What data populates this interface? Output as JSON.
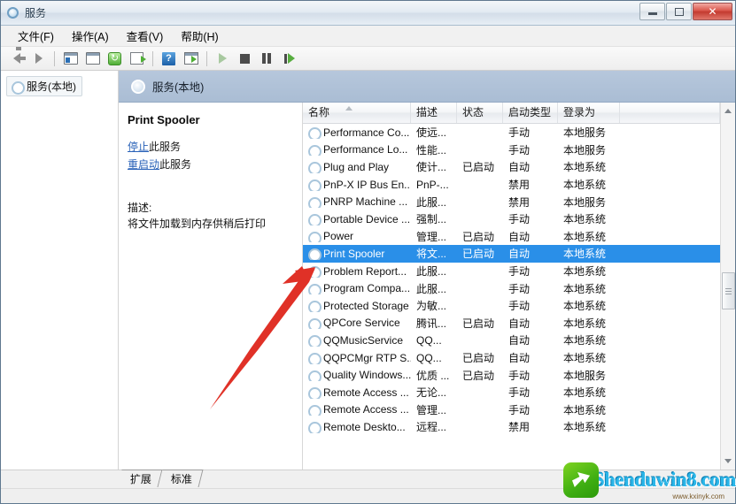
{
  "window": {
    "title": "服务",
    "title_icon": "services-gear-icon",
    "buttons": {
      "minimize": "minimize-icon",
      "maximize": "maximize-icon",
      "close": "✕"
    }
  },
  "menu": {
    "items": [
      {
        "label": "文件(F)",
        "name": "menu-file"
      },
      {
        "label": "操作(A)",
        "name": "menu-action"
      },
      {
        "label": "查看(V)",
        "name": "menu-view"
      },
      {
        "label": "帮助(H)",
        "name": "menu-help"
      }
    ]
  },
  "toolbar": {
    "items": [
      {
        "name": "back-icon"
      },
      {
        "name": "forward-icon"
      },
      {
        "name": "show-hide-tree-icon"
      },
      {
        "name": "properties-icon"
      },
      {
        "name": "refresh-icon"
      },
      {
        "name": "export-list-icon"
      },
      {
        "name": "help-icon"
      },
      {
        "name": "show-action-pane-icon"
      },
      {
        "name": "start-service-icon"
      },
      {
        "name": "stop-service-icon"
      },
      {
        "name": "pause-service-icon"
      },
      {
        "name": "restart-service-icon"
      }
    ]
  },
  "sidebar": {
    "items": [
      {
        "label": "服务(本地)",
        "name": "tree-item-services-local"
      }
    ]
  },
  "pane_header": {
    "title": "服务(本地)"
  },
  "detail": {
    "service_name": "Print Spooler",
    "stop_link": "停止",
    "stop_suffix": "此服务",
    "restart_link": "重启动",
    "restart_suffix": "此服务",
    "description_label": "描述:",
    "description_text": "将文件加载到内存供稍后打印"
  },
  "table": {
    "columns": [
      {
        "label": "名称",
        "name": "col-name"
      },
      {
        "label": "描述",
        "name": "col-description"
      },
      {
        "label": "状态",
        "name": "col-status"
      },
      {
        "label": "启动类型",
        "name": "col-startup-type"
      },
      {
        "label": "登录为",
        "name": "col-log-on-as"
      }
    ],
    "sort": "ascending",
    "rows": [
      {
        "name": "Performance Co...",
        "desc": "使远...",
        "status": "",
        "startup": "手动",
        "logon": "本地服务",
        "selected": false
      },
      {
        "name": "Performance Lo...",
        "desc": "性能...",
        "status": "",
        "startup": "手动",
        "logon": "本地服务",
        "selected": false
      },
      {
        "name": "Plug and Play",
        "desc": "使计...",
        "status": "已启动",
        "startup": "自动",
        "logon": "本地系统",
        "selected": false
      },
      {
        "name": "PnP-X IP Bus En...",
        "desc": "PnP-...",
        "status": "",
        "startup": "禁用",
        "logon": "本地系统",
        "selected": false
      },
      {
        "name": "PNRP Machine ...",
        "desc": "此服...",
        "status": "",
        "startup": "禁用",
        "logon": "本地服务",
        "selected": false
      },
      {
        "name": "Portable Device ...",
        "desc": "强制...",
        "status": "",
        "startup": "手动",
        "logon": "本地系统",
        "selected": false
      },
      {
        "name": "Power",
        "desc": "管理...",
        "status": "已启动",
        "startup": "自动",
        "logon": "本地系统",
        "selected": false
      },
      {
        "name": "Print Spooler",
        "desc": "将文...",
        "status": "已启动",
        "startup": "自动",
        "logon": "本地系统",
        "selected": true
      },
      {
        "name": "Problem Report...",
        "desc": "此服...",
        "status": "",
        "startup": "手动",
        "logon": "本地系统",
        "selected": false
      },
      {
        "name": "Program Compa...",
        "desc": "此服...",
        "status": "",
        "startup": "手动",
        "logon": "本地系统",
        "selected": false
      },
      {
        "name": "Protected Storage",
        "desc": "为敏...",
        "status": "",
        "startup": "手动",
        "logon": "本地系统",
        "selected": false
      },
      {
        "name": "QPCore Service",
        "desc": "腾讯...",
        "status": "已启动",
        "startup": "自动",
        "logon": "本地系统",
        "selected": false
      },
      {
        "name": "QQMusicService",
        "desc": "QQ...",
        "status": "",
        "startup": "自动",
        "logon": "本地系统",
        "selected": false
      },
      {
        "name": "QQPCMgr RTP S...",
        "desc": "QQ...",
        "status": "已启动",
        "startup": "自动",
        "logon": "本地系统",
        "selected": false
      },
      {
        "name": "Quality Windows...",
        "desc": "优质 ...",
        "status": "已启动",
        "startup": "手动",
        "logon": "本地服务",
        "selected": false
      },
      {
        "name": "Remote Access ...",
        "desc": "无论...",
        "status": "",
        "startup": "手动",
        "logon": "本地系统",
        "selected": false
      },
      {
        "name": "Remote Access ...",
        "desc": "管理...",
        "status": "",
        "startup": "手动",
        "logon": "本地系统",
        "selected": false
      },
      {
        "name": "Remote Deskto...",
        "desc": "远程...",
        "status": "",
        "startup": "禁用",
        "logon": "本地系统",
        "selected": false
      }
    ]
  },
  "footer": {
    "tabs": [
      {
        "label": "扩展",
        "name": "tab-extended"
      },
      {
        "label": "标准",
        "name": "tab-standard"
      }
    ]
  },
  "watermark": {
    "text": "Shenduwin8.com",
    "sub": "www.kxinyk.com"
  }
}
